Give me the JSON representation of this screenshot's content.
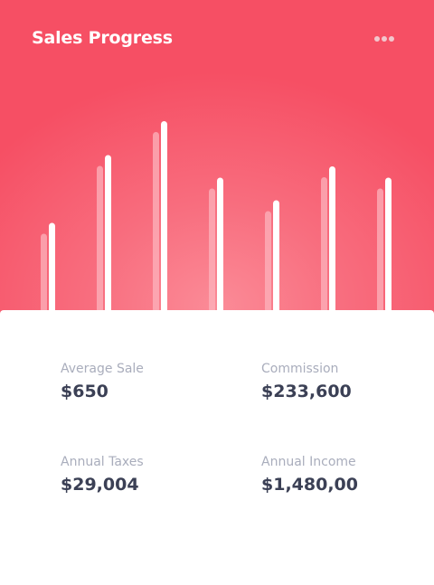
{
  "card": {
    "title": "Sales Progress",
    "menu_icon": "more-horizontal-icon"
  },
  "colors": {
    "header_gradient_edge": "#f64f64",
    "header_gradient_center": "#fb8b97",
    "bar_primary": "#ffffff",
    "bar_shadow": "#fcb3bc",
    "label": "#a9adbc",
    "value": "#3b4055"
  },
  "chart_data": {
    "type": "bar",
    "series": [
      {
        "values": [
          7,
          13,
          16,
          11,
          9,
          12,
          11
        ]
      },
      {
        "values": [
          8,
          14,
          16,
          12,
          10,
          13,
          12
        ]
      }
    ]
  },
  "stats": [
    {
      "label": "Average Sale",
      "value": "$650"
    },
    {
      "label": "Commission",
      "value": "$233,600"
    },
    {
      "label": "Annual Taxes",
      "value": "$29,004"
    },
    {
      "label": "Annual Income",
      "value": "$1,480,00"
    }
  ]
}
